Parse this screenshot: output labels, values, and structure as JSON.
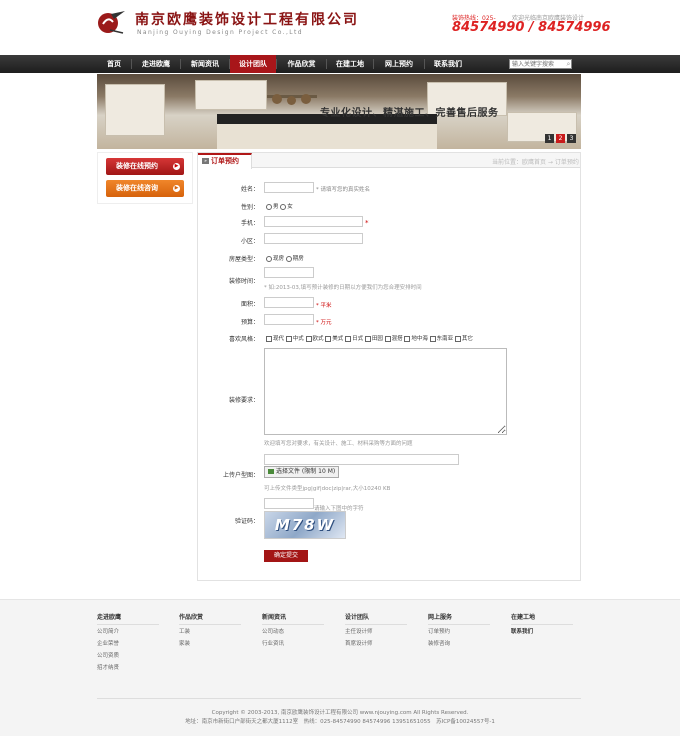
{
  "header": {
    "company_cn": "南京欧鹰装饰设计工程有限公司",
    "company_en": "Nanjing Ouying Design Project Co.,Ltd",
    "hotline_label": "装饰热线：025-",
    "welcome": "欢迎光临南京欧鹰装饰设计",
    "hotline_numbers": "84574990 / 84574996"
  },
  "nav": {
    "items": [
      "首页",
      "走进欧鹰",
      "新闻资讯",
      "设计团队",
      "作品欣赏",
      "在建工地",
      "网上预约",
      "联系我们"
    ],
    "active_index": 3,
    "search_placeholder": "输入关键字搜索",
    "search_icon": "search-icon"
  },
  "banner": {
    "slogan": "专业化设计、精湛施工、完善售后服务",
    "pages": [
      "1",
      "2",
      "3"
    ],
    "active_page": "2"
  },
  "sidebar": {
    "btn_online_booking": "装修在线预约",
    "btn_online_consult": "装修在线咨询"
  },
  "content": {
    "tab_title": "订单预约",
    "breadcrumb": "当前位置：欧鹰首页 → 订单预约"
  },
  "form": {
    "name_label": "姓名：",
    "name_hint": "* 请填写您的真实姓名",
    "gender_label": "性别：",
    "gender_male": "男",
    "gender_female": "女",
    "phone_label": "手机：",
    "community_label": "小区：",
    "house_type_label": "房屋类型：",
    "house_opt1": "现房",
    "house_opt2": "期房",
    "time_label": "装修时间：",
    "time_hint": "* 如:2013-03,填写预计装修的日期以方便我们为您合理安排时间",
    "area_label": "面积：",
    "area_unit": "* 平米",
    "budget_label": "预算：",
    "budget_unit": "* 万元",
    "style_label": "喜欢风格：",
    "styles": [
      "现代",
      "中式",
      "欧式",
      "美式",
      "日式",
      "田园",
      "混搭",
      "地中海",
      "东南亚",
      "其它"
    ],
    "requirement_label": "装修要求：",
    "requirement_hint": "欢迎填写您对要求，有关设计、施工、材料采购等方面的问题",
    "upload_label": "上传户型图：",
    "upload_button": "选择文件 (限制 10 M)",
    "upload_hint": "可上传文件类型jpg|gif|doc|zip|rar,大小10240 KB",
    "captcha_label": "验证码：",
    "captcha_hint": "请输入下图中的字符",
    "captcha_text": "M78W",
    "submit": "确定提交"
  },
  "footer": {
    "columns": [
      {
        "head": "走进欧鹰",
        "links": [
          "公司简介",
          "企业荣誉",
          "公司资质",
          "招才纳贤"
        ]
      },
      {
        "head": "作品欣赏",
        "links": [
          "工装",
          "家装"
        ]
      },
      {
        "head": "新闻资讯",
        "links": [
          "公司动态",
          "行业资讯"
        ]
      },
      {
        "head": "设计团队",
        "links": [
          "主任设计师",
          "首席设计师"
        ]
      },
      {
        "head": "网上服务",
        "links": [
          "订单预约",
          "装修咨询"
        ]
      },
      {
        "head": "在建工地",
        "links": [
          "联系我们"
        ]
      }
    ],
    "copyright": "Copyright © 2003-2013, 南京欧鹰装饰设计工程有限公司 www.njouying.com All Rights Reserved.",
    "address": "地址：南京市新街口户部街天之都大厦1112室　热线：025-84574990 84574996 13951651055　苏ICP备10024557号-1"
  }
}
